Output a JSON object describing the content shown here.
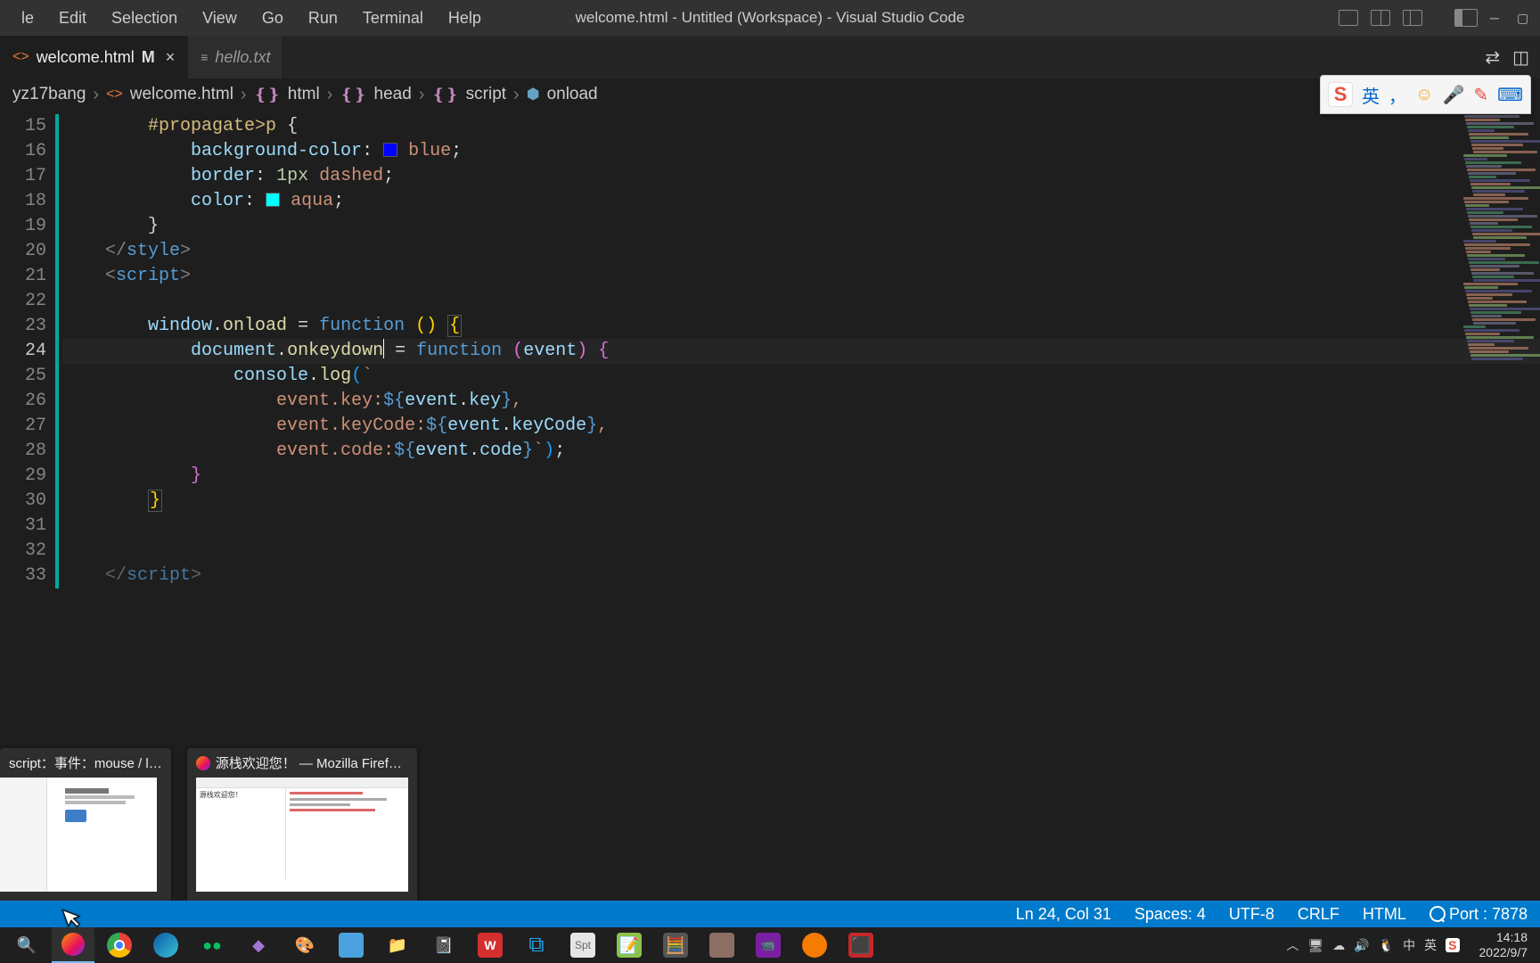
{
  "menu": {
    "file": "le",
    "edit": "Edit",
    "selection": "Selection",
    "view": "View",
    "go": "Go",
    "run": "Run",
    "terminal": "Terminal",
    "help": "Help",
    "title": "welcome.html - Untitled (Workspace) - Visual Studio Code"
  },
  "tabs": {
    "active": {
      "name": "welcome.html",
      "modified": "M"
    },
    "second": {
      "name": "hello.txt"
    }
  },
  "breadcrumb": {
    "root": "yz17bang",
    "file": "welcome.html",
    "html": "html",
    "head": "head",
    "script": "script",
    "onload": "onload"
  },
  "ime": {
    "lang": "英",
    "comma": "，"
  },
  "lines": {
    "start": 15,
    "end": 33,
    "active": 24
  },
  "code": {
    "l15_sel": "#propagate>p",
    "l16_prop": "background-color",
    "l16_val": "blue",
    "l16_swatch": "#0000ff",
    "l17_prop": "border",
    "l17_px": "1px",
    "l17_dashed": "dashed",
    "l18_prop": "color",
    "l18_val": "aqua",
    "l18_swatch": "#00ffff",
    "style_close": "style",
    "script_open": "script",
    "l23_win": "window",
    "l23_onload": "onload",
    "l23_func": "function",
    "l24_doc": "document",
    "l24_okd": "onkeydown",
    "l24_event": "event",
    "l25_console": "console",
    "l25_log": "log",
    "l26_txt": "event.key:",
    "l26_e": "event",
    "l26_k": "key",
    "l27_txt": "event.keyCode:",
    "l27_k": "keyCode",
    "l28_txt": "event.code:",
    "l28_k": "code",
    "script_close": "script"
  },
  "previews": {
    "p1": "script：事件：mouse / l…",
    "p2": "源栈欢迎您！ — Mozilla Firef…"
  },
  "status": {
    "ln": "Ln 24, Col 31",
    "spaces": "Spaces: 4",
    "enc": "UTF-8",
    "eol": "CRLF",
    "lang": "HTML",
    "port": "Port : 7878"
  },
  "tray": {
    "chevron": "^",
    "monitor": "▢",
    "cloud": "☁",
    "vol": "🔊",
    "wifi_cn": "中",
    "en": "英",
    "time": "14:18",
    "date": "2022/9/7"
  }
}
